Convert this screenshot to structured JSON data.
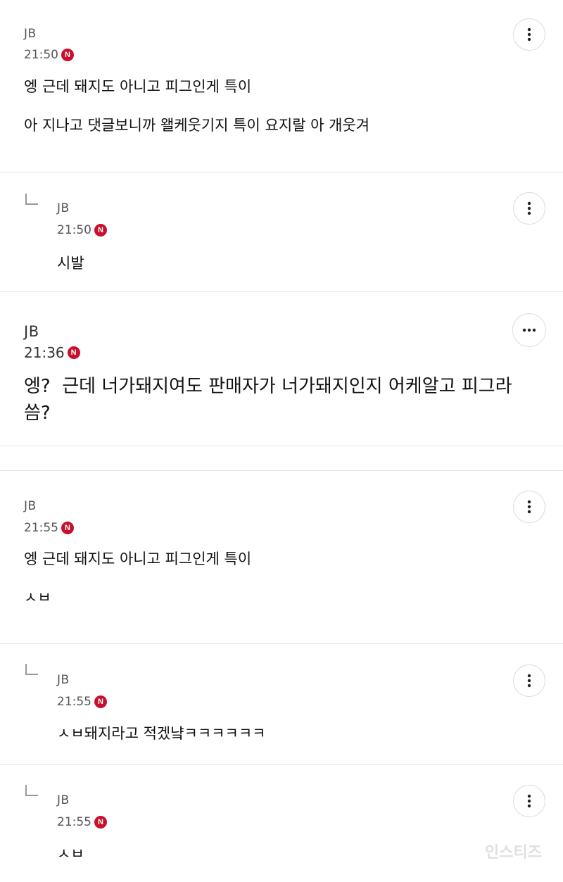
{
  "comments": [
    {
      "author": "JB",
      "time": "21:50",
      "badge": "N",
      "text": "엥 근데 돼지도 아니고 피그인게 특이\n\n아 지나고 댓글보니까 왤케웃기지 특이 요지랄 아 개웃겨",
      "more": "more-options"
    },
    {
      "author": "JB",
      "time": "21:50",
      "badge": "N",
      "text": "시발",
      "more": "more-options"
    },
    {
      "author": "JB",
      "time": "21:36",
      "badge": "N",
      "text": "엥?  근데 너가돼지여도 판매자가 너가돼지인지 어케알고 피그라\n씀?",
      "more": "more-options"
    },
    {
      "author": "JB",
      "time": "21:55",
      "badge": "N",
      "text": "엥 근데 돼지도 아니고 피그인게 특이\n\nㅅㅂ",
      "more": "more-options"
    },
    {
      "author": "JB",
      "time": "21:55",
      "badge": "N",
      "text": "ㅅㅂ돼지라고 적겠냨ㅋㅋㅋㅋㅋㅋ",
      "more": "more-options"
    },
    {
      "author": "JB",
      "time": "21:55",
      "badge": "N",
      "text": "ㅅㅂ",
      "more": "more-options"
    }
  ],
  "watermark": "인스티즈"
}
